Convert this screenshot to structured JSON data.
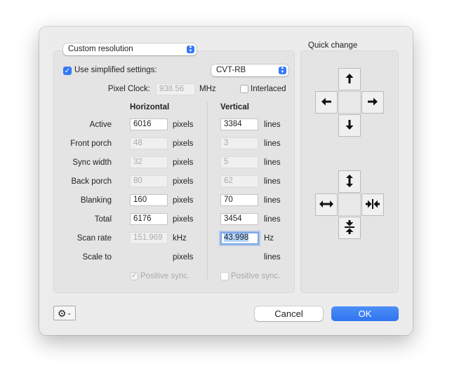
{
  "mode_popup": {
    "value": "Custom resolution"
  },
  "simplified": {
    "label": "Use simplified settings:",
    "checked": true
  },
  "timing_popup": {
    "value": "CVT-RB"
  },
  "pixel_clock": {
    "label": "Pixel Clock:",
    "value": "938.56",
    "unit": "MHz"
  },
  "interlaced": {
    "label": "Interlaced",
    "checked": false
  },
  "columns": {
    "horizontal": "Horizontal",
    "vertical": "Vertical"
  },
  "rows": [
    {
      "label": "Active",
      "h_value": "6016",
      "h_unit": "pixels",
      "v_value": "3384",
      "v_unit": "lines"
    },
    {
      "label": "Front porch",
      "h_value": "48",
      "h_unit": "pixels",
      "v_value": "3",
      "v_unit": "lines"
    },
    {
      "label": "Sync width",
      "h_value": "32",
      "h_unit": "pixels",
      "v_value": "5",
      "v_unit": "lines"
    },
    {
      "label": "Back porch",
      "h_value": "80",
      "h_unit": "pixels",
      "v_value": "62",
      "v_unit": "lines"
    },
    {
      "label": "Blanking",
      "h_value": "160",
      "h_unit": "pixels",
      "v_value": "70",
      "v_unit": "lines"
    },
    {
      "label": "Total",
      "h_value": "6176",
      "h_unit": "pixels",
      "v_value": "3454",
      "v_unit": "lines"
    },
    {
      "label": "Scan rate",
      "h_value": "151.969",
      "h_unit": "kHz",
      "v_value": "43.998",
      "v_unit": "Hz"
    },
    {
      "label": "Scale to",
      "h_value": "",
      "h_unit": "pixels",
      "v_value": "",
      "v_unit": "lines"
    }
  ],
  "positive_sync": {
    "h_label": "Positive sync.",
    "v_label": "Positive sync."
  },
  "quick_change": {
    "title": "Quick change"
  },
  "icons": {
    "up": "arrow-up-icon",
    "left": "arrow-left-icon",
    "right": "arrow-right-icon",
    "down": "arrow-down-icon",
    "expand_v": "expand-vertical-icon",
    "expand_h": "expand-horizontal-icon",
    "shrink_h": "shrink-horizontal-icon",
    "shrink_v": "shrink-vertical-icon",
    "gear": "gear-icon",
    "chevron": "chevron-down-icon"
  },
  "buttons": {
    "cancel": "Cancel",
    "ok": "OK"
  },
  "colors": {
    "accent": "#3478f6",
    "ok_button": "#3b82f6"
  }
}
